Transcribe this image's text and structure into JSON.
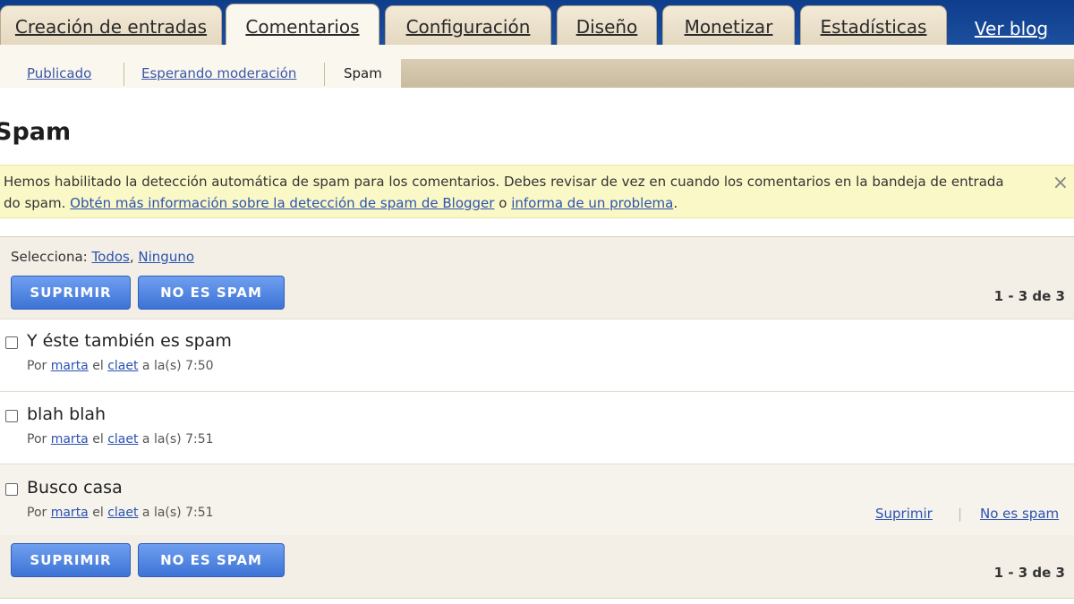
{
  "nav": {
    "tabs": [
      {
        "label": "Creación de entradas"
      },
      {
        "label": "Comentarios"
      },
      {
        "label": "Configuración"
      },
      {
        "label": "Diseño"
      },
      {
        "label": "Monetizar"
      },
      {
        "label": "Estadísticas"
      }
    ],
    "view_blog": "Ver blog",
    "active_tab": "Comentarios"
  },
  "subnav": {
    "items": [
      {
        "label": "Publicado"
      },
      {
        "label": "Esperando moderación"
      },
      {
        "label": "Spam"
      }
    ],
    "active": "Spam"
  },
  "page": {
    "title": "Spam"
  },
  "notice": {
    "text_1": "Hemos habilitado la detección automática de spam para los comentarios. Debes revisar de vez en cuando los comentarios en la bandeja de entrada do spam.",
    "link_1": "Obtén más información sobre la detección de spam de Blogger",
    "text_2": "o",
    "link_2": "informa de un problema",
    "text_3": ".",
    "close": "×"
  },
  "toolbar": {
    "select_label": "Selecciona:",
    "select_all": "Todos",
    "select_sep": ",",
    "select_none": "Ninguno",
    "delete_btn": "SUPRIMIR",
    "not_spam_btn": "NO ES SPAM",
    "pager": "1 - 3 de 3"
  },
  "comments": [
    {
      "title": "Y éste también es spam",
      "by": "Por",
      "author": "marta",
      "on": "el",
      "post": "claet",
      "time": "a la(s) 7:50"
    },
    {
      "title": "blah blah",
      "by": "Por",
      "author": "marta",
      "on": "el",
      "post": "claet",
      "time": "a la(s) 7:51"
    },
    {
      "title": "Busco casa",
      "by": "Por",
      "author": "marta",
      "on": "el",
      "post": "claet",
      "time": "a la(s) 7:51"
    }
  ],
  "row_actions": {
    "delete": "Suprimir",
    "separator": "|",
    "not_spam": "No es spam"
  },
  "colors": {
    "header_blue": "#1c4f9e",
    "button_blue": "#4a7fdf",
    "link_blue": "#2b52b0",
    "notice_yellow": "#fbf8c8"
  }
}
